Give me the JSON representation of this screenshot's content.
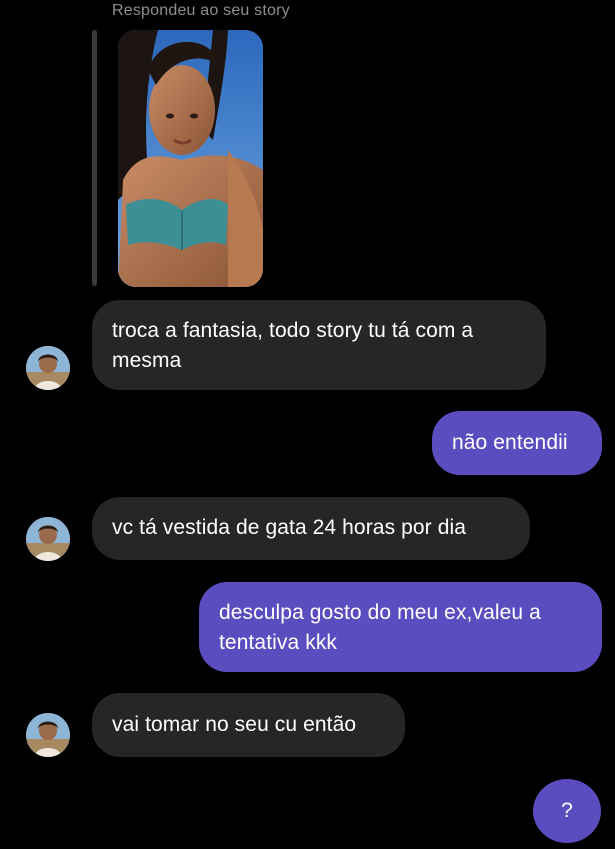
{
  "story": {
    "caption": "Respondeu ao seu story"
  },
  "messages": [
    {
      "side": "in",
      "text": "troca a fantasia, todo story tu tá com a mesma"
    },
    {
      "side": "out",
      "text": "não entendii"
    },
    {
      "side": "in",
      "text": "vc tá vestida de gata 24 horas por dia"
    },
    {
      "side": "out",
      "text": "desculpa gosto do meu ex,valeu a tentativa kkk"
    },
    {
      "side": "in",
      "text": "vai tomar no seu cu então"
    }
  ],
  "pending_button": {
    "label": "?"
  },
  "colors": {
    "background": "#000000",
    "incoming_bubble": "#262626",
    "outgoing_bubble": "#5b4cc0",
    "caption": "#8e8e8e"
  }
}
